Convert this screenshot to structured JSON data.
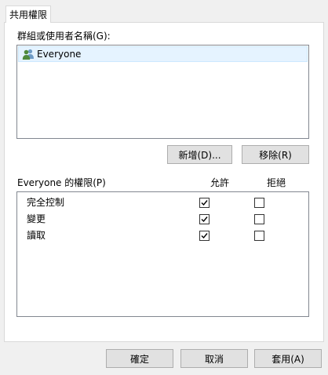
{
  "tab": {
    "label": "共用權限"
  },
  "groups": {
    "label": "群組或使用者名稱(G):",
    "items": [
      {
        "name": "Everyone",
        "icon": "users-group-icon",
        "selected": true
      }
    ]
  },
  "buttons": {
    "add": "新增(D)...",
    "remove": "移除(R)"
  },
  "permissions": {
    "label": "Everyone 的權限(P)",
    "allow_header": "允許",
    "deny_header": "拒絕",
    "rows": [
      {
        "name": "完全控制",
        "allow": true,
        "deny": false
      },
      {
        "name": "變更",
        "allow": true,
        "deny": false
      },
      {
        "name": "讀取",
        "allow": true,
        "deny": false
      }
    ]
  },
  "footer": {
    "ok": "確定",
    "cancel": "取消",
    "apply": "套用(A)"
  }
}
